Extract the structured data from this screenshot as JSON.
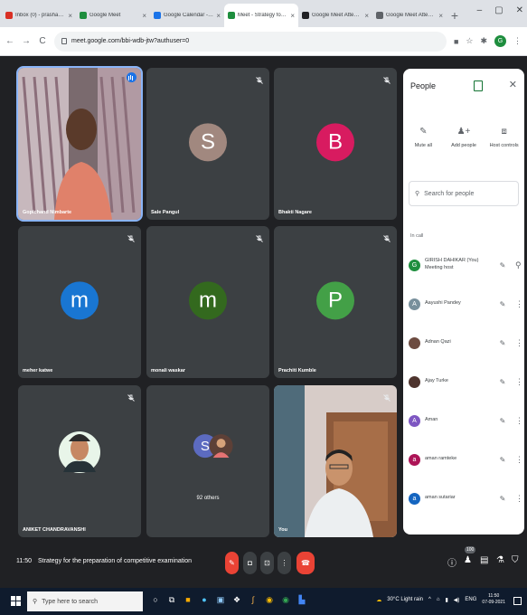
{
  "browser": {
    "tabs": [
      {
        "title": "Inbox (0) - prashant10@gm…",
        "color": "#d93025"
      },
      {
        "title": "Google Meet",
        "color": "#1e8e3e"
      },
      {
        "title": "Google Calendar - Thursd…",
        "color": "#1a73e8"
      },
      {
        "title": "Meet - Strategy for th…",
        "color": "#1e8e3e"
      },
      {
        "title": "Google Meet Attendance …",
        "color": "#202124"
      },
      {
        "title": "Google Meet Attendance - …",
        "color": "#5f6368"
      }
    ],
    "active_tab": 3,
    "url": "meet.google.com/bbi-wdb-jtw?authuser=0"
  },
  "tiles": [
    {
      "name": "Gopichand Nimbarte",
      "type": "video",
      "muted": false,
      "speaking": true
    },
    {
      "name": "Sale Pangul",
      "type": "avatar",
      "letter": "S",
      "color": "#a1887f",
      "muted": true
    },
    {
      "name": "Bhakti Nagare",
      "type": "avatar",
      "letter": "B",
      "color": "#d81b60",
      "muted": true
    },
    {
      "name": "meher katwe",
      "type": "avatar",
      "letter": "m",
      "color": "#1976d2",
      "muted": true
    },
    {
      "name": "monali waskar",
      "type": "avatar",
      "letter": "m",
      "color": "#33691e",
      "muted": true
    },
    {
      "name": "Prachiti Kumble",
      "type": "avatar",
      "letter": "P",
      "color": "#43a047",
      "muted": true
    },
    {
      "name": "ANIKET CHANDRAVANSHI",
      "type": "photo",
      "muted": true
    },
    {
      "name": "92 others",
      "type": "group",
      "letter": "S",
      "color": "#5c6bc0"
    },
    {
      "name": "You",
      "type": "video-self",
      "muted": true
    }
  ],
  "people_panel": {
    "title": "People",
    "actions": [
      {
        "label": "Mute all",
        "icon": "mute-all-icon"
      },
      {
        "label": "Add people",
        "icon": "add-person-icon"
      },
      {
        "label": "Host controls",
        "icon": "host-controls-icon"
      }
    ],
    "search_placeholder": "Search for people",
    "section": "In call",
    "participants": [
      {
        "name": "GIRISH DAHIKAR (You)",
        "sub": "Meeting host",
        "letter": "G",
        "color": "#1e8e3e"
      },
      {
        "name": "Aayushi Pandey",
        "sub": "",
        "letter": "A",
        "color": "#78909c"
      },
      {
        "name": "Adnan Qazi",
        "sub": "",
        "letter": "",
        "color": "#6d4c41"
      },
      {
        "name": "Ajay Turke",
        "sub": "",
        "letter": "",
        "color": "#4e342e"
      },
      {
        "name": "Aman",
        "sub": "",
        "letter": "A",
        "color": "#7e57c2"
      },
      {
        "name": "aman ramteke",
        "sub": "",
        "letter": "a",
        "color": "#ad1457"
      },
      {
        "name": "aman sutariar",
        "sub": "",
        "letter": "a",
        "color": "#1565c0"
      }
    ]
  },
  "meeting": {
    "time": "11:50",
    "title": "Strategy for the preparation of competitive examination",
    "participant_count": "100"
  },
  "taskbar": {
    "search_placeholder": "Type here to search",
    "weather": "30°C Light rain",
    "language": "ENG",
    "time": "11:50",
    "date": "07-09-2021"
  }
}
